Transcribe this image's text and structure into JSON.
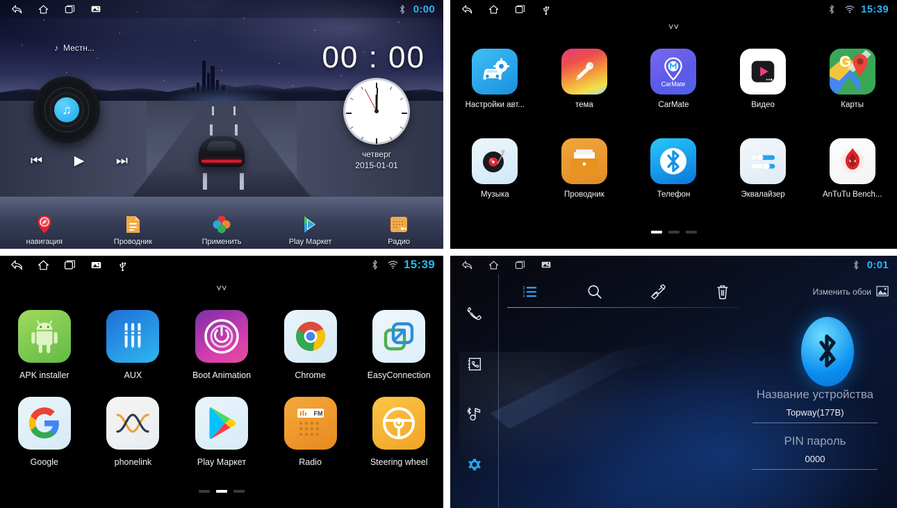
{
  "panels": {
    "home": {
      "status": {
        "time": "0:00",
        "icons": [
          "back-icon",
          "home-icon",
          "recents-icon",
          "screenshot-icon"
        ],
        "right_icons": [
          "bluetooth-icon"
        ]
      },
      "now_playing": "Местн...",
      "big_clock": "00 : 00",
      "clock_day": "четверг",
      "clock_date": "2015-01-01",
      "media_controls": [
        "prev-track-button",
        "play-button",
        "next-track-button"
      ],
      "dock": [
        {
          "label": "навигация",
          "icon": "navigation-pin-icon"
        },
        {
          "label": "Проводник",
          "icon": "file-manager-icon"
        },
        {
          "label": "Применить",
          "icon": "apply-flower-icon"
        },
        {
          "label": "Play Маркет",
          "icon": "play-store-icon"
        },
        {
          "label": "Радио",
          "icon": "radio-icon"
        }
      ]
    },
    "drawer_a": {
      "status": {
        "time": "15:39",
        "icons": [
          "back-icon",
          "home-icon",
          "recents-icon",
          "usb-icon"
        ],
        "right_icons": [
          "bluetooth-icon",
          "wifi-icon"
        ]
      },
      "apps": [
        {
          "label": "Настройки авт...",
          "icon": "car-settings-icon"
        },
        {
          "label": "тема",
          "icon": "theme-brush-icon"
        },
        {
          "label": "CarMate",
          "icon": "carmate-icon"
        },
        {
          "label": "Видео",
          "icon": "video-player-icon"
        },
        {
          "label": "Карты",
          "icon": "google-maps-icon"
        },
        {
          "label": "Музыка",
          "icon": "music-turntable-icon"
        },
        {
          "label": "Проводник",
          "icon": "file-explorer-icon"
        },
        {
          "label": "Телефон",
          "icon": "bluetooth-phone-icon"
        },
        {
          "label": "Эквалайзер",
          "icon": "equalizer-icon"
        },
        {
          "label": "AnTuTu Bench...",
          "icon": "antutu-icon"
        }
      ],
      "page_dots": {
        "count": 3,
        "active": 0
      }
    },
    "drawer_b": {
      "status": {
        "time": "15:39",
        "icons": [
          "back-icon",
          "home-icon",
          "recents-icon",
          "screenshot-icon",
          "usb-icon"
        ],
        "right_icons": [
          "bluetooth-icon",
          "wifi-icon"
        ]
      },
      "apps": [
        {
          "label": "APK installer",
          "icon": "android-robot-icon"
        },
        {
          "label": "AUX",
          "icon": "aux-jack-icon"
        },
        {
          "label": "Boot Animation",
          "icon": "power-ring-icon"
        },
        {
          "label": "Chrome",
          "icon": "chrome-icon"
        },
        {
          "label": "EasyConnection",
          "icon": "easyconnection-icon"
        },
        {
          "label": "Google",
          "icon": "google-g-icon"
        },
        {
          "label": "phonelink",
          "icon": "phonelink-icon"
        },
        {
          "label": "Play Маркет",
          "icon": "play-store-icon"
        },
        {
          "label": "Radio",
          "icon": "radio-fm-icon"
        },
        {
          "label": "Steering wheel",
          "icon": "steering-wheel-icon"
        }
      ],
      "page_dots": {
        "count": 3,
        "active": 1
      }
    },
    "bluetooth": {
      "status": {
        "time": "0:01",
        "icons": [
          "back-icon",
          "home-icon",
          "recents-icon",
          "screenshot-icon"
        ],
        "right_icons": [
          "bluetooth-icon"
        ]
      },
      "sidebar": [
        {
          "icon": "phone-handset-icon",
          "active": false
        },
        {
          "icon": "contacts-book-icon",
          "active": false
        },
        {
          "icon": "bluetooth-music-icon",
          "active": false
        },
        {
          "icon": "settings-gear-icon",
          "active": true
        }
      ],
      "toolbar": [
        {
          "icon": "list-icon",
          "active": true
        },
        {
          "icon": "search-icon",
          "active": false
        },
        {
          "icon": "pair-hand-icon",
          "active": false
        },
        {
          "icon": "trash-icon",
          "active": false
        }
      ],
      "wallpaper_label": "Изменить обои",
      "wallpaper_icon": "image-icon",
      "logo_icon": "bluetooth-logo-icon",
      "fields": [
        {
          "label": "Название устройства",
          "value": "Topway(177B)"
        },
        {
          "label": "PIN пароль",
          "value": "0000"
        }
      ]
    }
  },
  "colors": {
    "accent_time": "#29b6f6",
    "bt_blue": "#0a8ff0",
    "drawer_bg": "#000000"
  }
}
